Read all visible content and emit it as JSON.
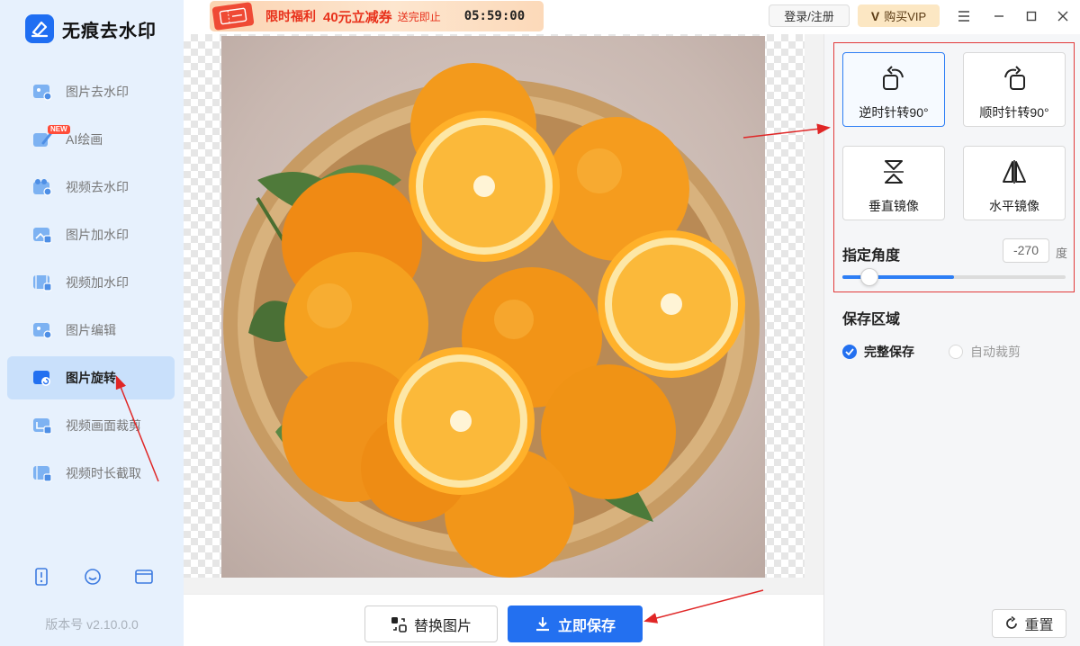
{
  "app": {
    "title": "无痕去水印",
    "version": "版本号 v2.10.0.0"
  },
  "sidebar": {
    "items": [
      {
        "label": "图片去水印",
        "icon": "image-watermark-remove-icon",
        "active": false
      },
      {
        "label": "AI绘画",
        "icon": "ai-paint-icon",
        "active": false,
        "badge": "NEW"
      },
      {
        "label": "视频去水印",
        "icon": "video-watermark-remove-icon",
        "active": false
      },
      {
        "label": "图片加水印",
        "icon": "image-watermark-add-icon",
        "active": false
      },
      {
        "label": "视频加水印",
        "icon": "video-watermark-add-icon",
        "active": false
      },
      {
        "label": "图片编辑",
        "icon": "image-edit-icon",
        "active": false
      },
      {
        "label": "图片旋转",
        "icon": "image-rotate-icon",
        "active": true
      },
      {
        "label": "视频画面裁剪",
        "icon": "video-crop-icon",
        "active": false
      },
      {
        "label": "视频时长截取",
        "icon": "video-trim-icon",
        "active": false
      }
    ],
    "bottom_icons": [
      "phone-icon",
      "customer-service-icon",
      "window-icon"
    ]
  },
  "topbar": {
    "promo": {
      "label": "限时福利",
      "offer": "40元立减券",
      "suffix": "送完即止",
      "timer": "05:59:00"
    },
    "login_label": "登录/注册",
    "vip_logo": "V",
    "vip_label": "购买VIP"
  },
  "actions": {
    "replace_label": "替换图片",
    "save_label": "立即保存"
  },
  "rotate_panel": {
    "buttons": [
      {
        "label": "逆时针转90°",
        "icon": "rotate-ccw-icon",
        "selected": true
      },
      {
        "label": "顺时针转90°",
        "icon": "rotate-cw-icon",
        "selected": false
      },
      {
        "label": "垂直镜像",
        "icon": "flip-vertical-icon",
        "selected": false
      },
      {
        "label": "水平镜像",
        "icon": "flip-horizontal-icon",
        "selected": false
      }
    ],
    "angle_title": "指定角度",
    "angle_value": "-270",
    "angle_unit": "度",
    "slider_fraction": 0.12,
    "slider_fill_fraction": 0.5,
    "save_area_title": "保存区域",
    "options": [
      {
        "label": "完整保存",
        "checked": true
      },
      {
        "label": "自动裁剪",
        "checked": false
      }
    ],
    "reset_label": "重置"
  },
  "colors": {
    "accent": "#2370f0",
    "sidebar_bg": "#e7f1fd",
    "highlight_box": "#e23a3a",
    "promo_text": "#e8311b"
  }
}
